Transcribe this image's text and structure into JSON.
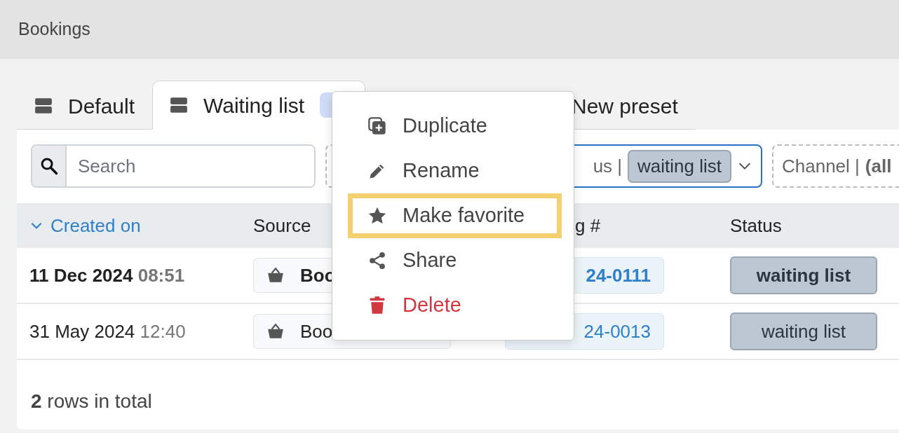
{
  "window": {
    "title": "Bookings"
  },
  "tabs": [
    {
      "label": "Default",
      "selected": false,
      "badge": false
    },
    {
      "label": "Waiting list",
      "selected": true,
      "badge": true
    },
    {
      "label": "New preset",
      "selected": false,
      "badge": false
    }
  ],
  "search": {
    "placeholder": "Search"
  },
  "filters": [
    {
      "kind": "dashed"
    },
    {
      "kind": "active",
      "label": "us |",
      "value": "waiting list"
    },
    {
      "kind": "dashed",
      "label": "Channel |",
      "value": "(all"
    }
  ],
  "table": {
    "columns": [
      {
        "label": "Created on",
        "sorted": true
      },
      {
        "label": "Source",
        "sorted": false
      },
      {
        "label": "g #",
        "sorted": false
      },
      {
        "label": "Status",
        "sorted": false
      }
    ],
    "rows": [
      {
        "date": "11 Dec 2024",
        "time": "08:51",
        "source": "Boo",
        "booking": "24-0111",
        "status": "waiting list",
        "bold": true
      },
      {
        "date": "31 May 2024",
        "time": "12:40",
        "source": "Boo",
        "booking": "24-0013",
        "status": "waiting list",
        "bold": false
      }
    ]
  },
  "footer": "**2** rows in total",
  "menu": {
    "items": [
      {
        "label": "Duplicate",
        "highlighted": false,
        "danger": false
      },
      {
        "label": "Rename",
        "highlighted": false,
        "danger": false
      },
      {
        "label": "Make favorite",
        "highlighted": true,
        "danger": false
      },
      {
        "label": "Share",
        "highlighted": false,
        "danger": false
      },
      {
        "label": "Delete",
        "highlighted": false,
        "danger": true
      }
    ]
  }
}
